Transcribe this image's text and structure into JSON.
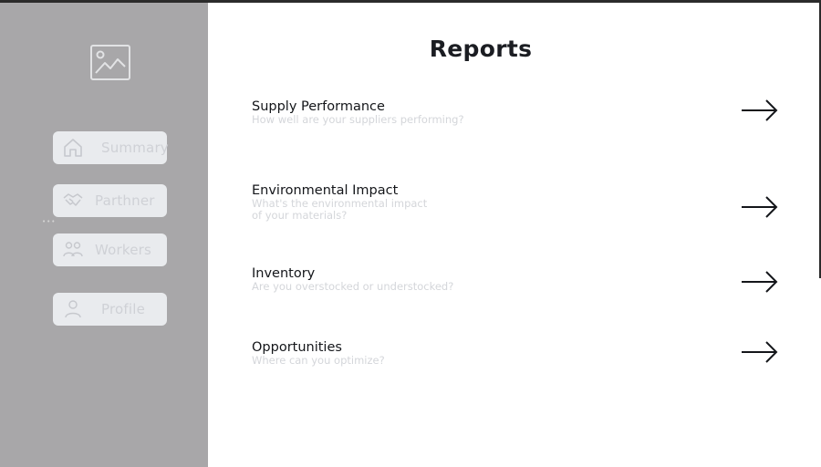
{
  "sidebar": {
    "logo_icon": "image-placeholder-icon",
    "items": [
      {
        "label": "Summary",
        "icon": "home-icon"
      },
      {
        "label": "Parthner",
        "icon": "handshake-icon"
      },
      {
        "label": "Workers",
        "icon": "users-icon"
      },
      {
        "label": "Profile",
        "icon": "user-icon"
      }
    ]
  },
  "main": {
    "title": "Reports",
    "reports": [
      {
        "title": "Supply Performance",
        "description": "How well are your suppliers performing?"
      },
      {
        "title": "Environmental Impact",
        "description": "What's the environmental impact\nof your materials?"
      },
      {
        "title": "Inventory",
        "description": "Are you overstocked or understocked?"
      },
      {
        "title": "Opportunities",
        "description": "Where can you optimize?"
      }
    ],
    "arrow_icon": "arrow-right-icon"
  },
  "colors": {
    "sidebar_bg": "#a8a7a9",
    "nav_item_bg": "#e9ebee",
    "nav_text": "#cfd1d6",
    "title_text": "#1b1d22",
    "desc_text": "#d4d6da"
  }
}
